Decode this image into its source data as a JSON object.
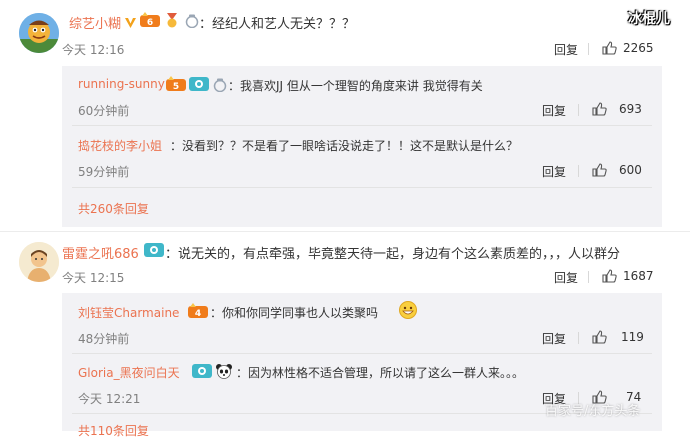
{
  "watermark_top": "冰棍儿",
  "watermark_bottom": "百家号/东方头条",
  "comments": [
    {
      "user": "综艺小糊",
      "text": "：经纪人和艺人无关？？？",
      "time": "今天 12:16",
      "reply_label": "回复",
      "likes": "2265",
      "replies": [
        {
          "user": "running-sunny",
          "text": "：我喜欢JJ 但从一个理智的角度来讲 我觉得有关",
          "time": "60分钟前",
          "reply_label": "回复",
          "likes": "693"
        },
        {
          "user": "捣花枝的李小姐",
          "text": "：没看到？？不是看了一眼啥话没说走了！！这不是默认是什么？",
          "time": "59分钟前",
          "reply_label": "回复",
          "likes": "600"
        }
      ],
      "more_replies": "共260条回复"
    },
    {
      "user": "雷霆之吼686",
      "text": "：说无关的，有点牵强，毕竟整天待一起，身边有个这么素质差的，，，人以群分",
      "time": "今天 12:15",
      "reply_label": "回复",
      "likes": "1687",
      "replies": [
        {
          "user": "刘钰莹Charmaine",
          "text": "：你和你同学同事也人以类聚吗",
          "time": "48分钟前",
          "reply_label": "回复",
          "likes": "119"
        },
        {
          "user": "Gloria_黑夜问白天",
          "text": "：因为林性格不适合管理，所以请了这么一群人来。。。",
          "time": "今天 12:21",
          "reply_label": "回复",
          "likes": "74"
        }
      ],
      "more_replies": "共110条回复"
    }
  ],
  "icons": [
    "verified-v-icon",
    "vip-crown-icon",
    "medal-icon",
    "thumbs-up-icon",
    "fan-badge-icon",
    "panda-icon",
    "grin-emoji-icon"
  ]
}
